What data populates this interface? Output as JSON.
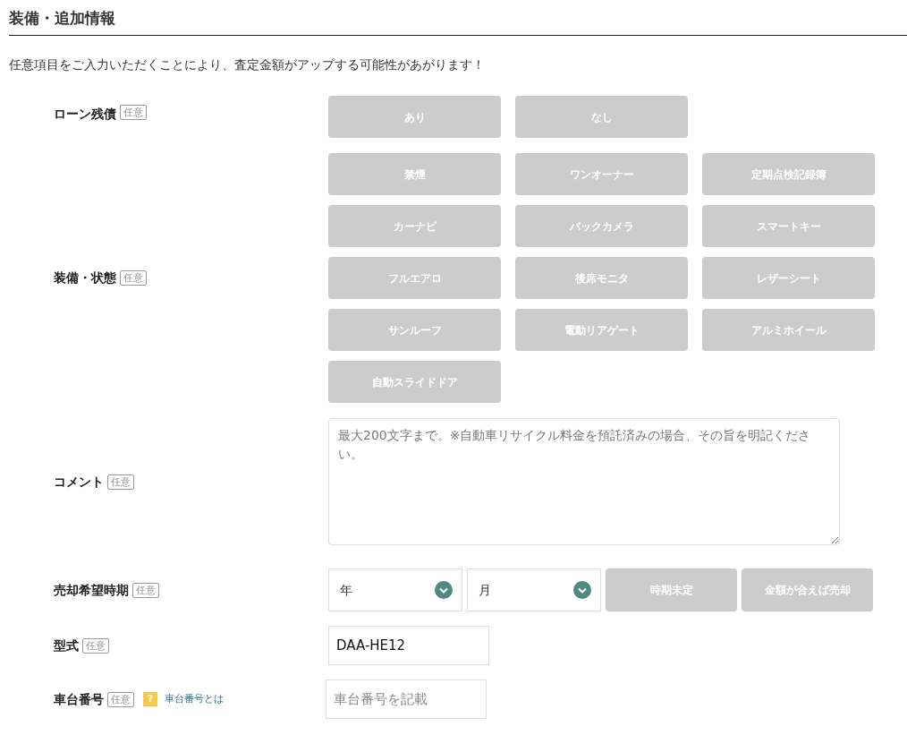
{
  "section_title": "装備・追加情報",
  "intro": "任意項目をご入力いただくことにより、査定金額がアップする可能性があがります！",
  "loan": {
    "label": "ローン残債",
    "tag": "任意",
    "options": [
      {
        "label": "あり",
        "selected": false
      },
      {
        "label": "なし",
        "selected": false
      }
    ]
  },
  "equipment": {
    "label": "装備・状態",
    "tag": "任意",
    "options": [
      {
        "label": "禁煙",
        "selected": false
      },
      {
        "label": "ワンオーナー",
        "selected": false
      },
      {
        "label": "定期点検記録簿",
        "selected": false
      },
      {
        "label": "カーナビ",
        "selected": false
      },
      {
        "label": "バックカメラ",
        "selected": false
      },
      {
        "label": "スマートキー",
        "selected": false
      },
      {
        "label": "フルエアロ",
        "selected": false
      },
      {
        "label": "後席モニタ",
        "selected": false
      },
      {
        "label": "レザーシート",
        "selected": false
      },
      {
        "label": "サンルーフ",
        "selected": false
      },
      {
        "label": "電動リアゲート",
        "selected": false
      },
      {
        "label": "アルミホイール",
        "selected": false
      },
      {
        "label": "自動スライドドア",
        "selected": false
      }
    ]
  },
  "comment": {
    "label": "コメント",
    "tag": "任意",
    "placeholder": "最大200文字まで。※自動車リサイクル料金を預託済みの場合、その旨を明記ください。"
  },
  "sale_timing": {
    "label": "売却希望時期",
    "tag": "任意",
    "selects": [
      {
        "value": "年"
      },
      {
        "value": "月"
      }
    ],
    "options": [
      {
        "label": "時期未定",
        "selected": false
      },
      {
        "label": "金額が合えば売却",
        "selected": false
      }
    ]
  },
  "model": {
    "label": "型式",
    "tag": "任意",
    "value": "DAA-HE12"
  },
  "chassis": {
    "label": "車台番号",
    "tag": "任意",
    "help_icon": "?",
    "help_link": "車台番号とは",
    "placeholder": "車台番号を記載"
  }
}
